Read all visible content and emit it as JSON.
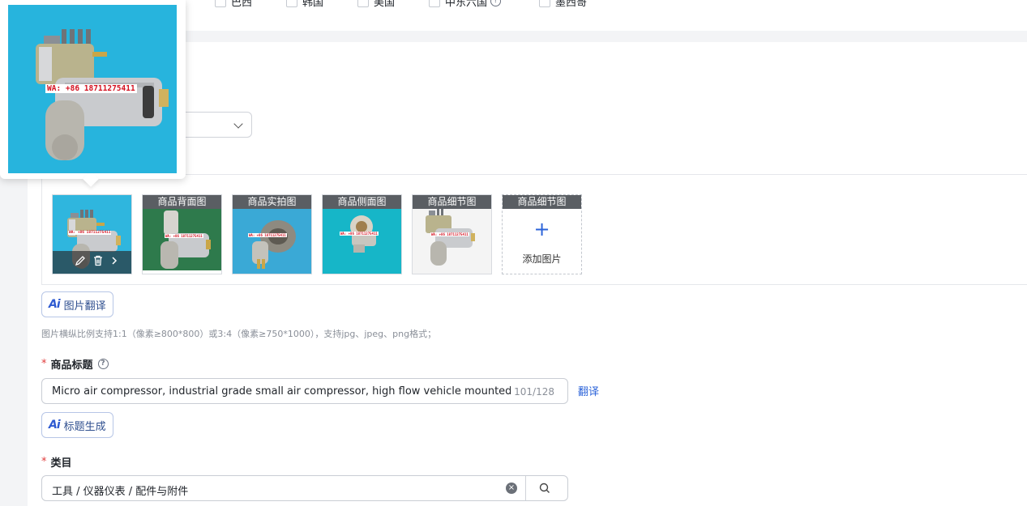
{
  "countries": [
    {
      "label": "巴西"
    },
    {
      "label": "韩国"
    },
    {
      "label": "美国"
    },
    {
      "label": "中东六国"
    },
    {
      "label": "墨西哥"
    }
  ],
  "help_glyph": "?",
  "images": {
    "watermark": "WA: +86 18711275411",
    "thumbs": [
      {
        "label": "商品背面图"
      },
      {
        "label": "商品实拍图"
      },
      {
        "label": "商品侧面图"
      },
      {
        "label": "商品细节图"
      }
    ],
    "add_slot_label": "商品细节图",
    "add_plus": "+",
    "add_text": "添加图片",
    "ai_translate_label": "图片翻译",
    "hint": "图片横纵比例支持1:1（像素≥800*800）或3:4（像素≥750*1000），支持jpg、jpeg、png格式；"
  },
  "ai_mark": "Ai",
  "title_field": {
    "label": "商品标题",
    "required_mark": "*",
    "value": "Micro air compressor, industrial grade small air compressor, high flow vehicle mounted inflatable pump",
    "counter": "101/128",
    "translate_link": "翻译",
    "ai_generate_label": "标题生成"
  },
  "category_field": {
    "label": "类目",
    "required_mark": "*",
    "value": "工具 / 仪器仪表 / 配件与附件",
    "clear_glyph": "×"
  },
  "colors": {
    "accent": "#2b63d9",
    "required": "#e03c3c",
    "preview_bg": "#27b4dd",
    "watermark": "#d4101f"
  }
}
